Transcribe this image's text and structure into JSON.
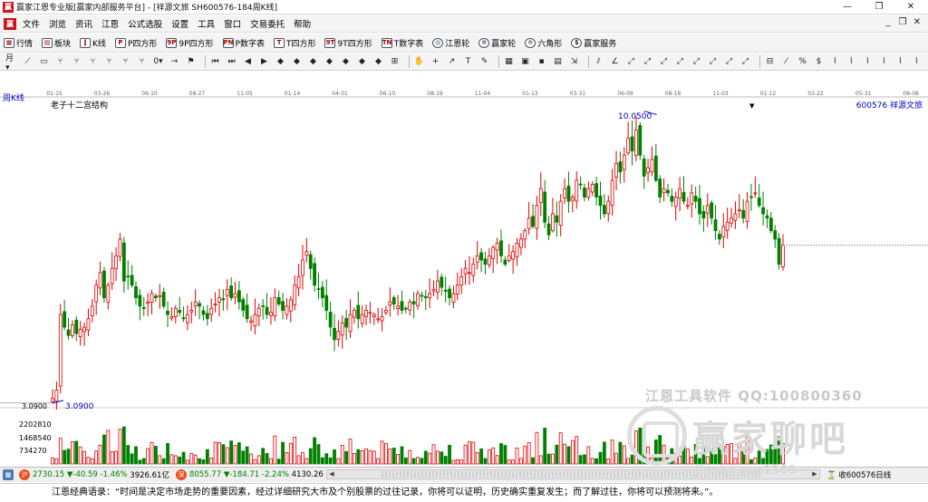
{
  "window": {
    "title": "赢家江恩专业版[赢家内部服务平台] - [祥源文旅  SH600576-184周K线]",
    "minimize": "—",
    "maximize": "❐",
    "close": "✕"
  },
  "menu": {
    "items": [
      "文件",
      "浏览",
      "资讯",
      "江恩",
      "公式选股",
      "设置",
      "工具",
      "窗口",
      "交易委托",
      "帮助"
    ]
  },
  "toolbar1": {
    "items": [
      {
        "label": "行情",
        "icon": "grid-icon"
      },
      {
        "label": "板块",
        "icon": "blocks-icon"
      },
      {
        "label": "K线",
        "icon": "candle-icon"
      },
      {
        "label": "P四方形",
        "icon": "p-square-icon"
      },
      {
        "label": "9P四方形",
        "icon": "9p-square-icon"
      },
      {
        "label": "P数字表",
        "icon": "p-table-icon"
      },
      {
        "label": "T四方形",
        "icon": "t-square-icon"
      },
      {
        "label": "9T四方形",
        "icon": "9t-square-icon"
      },
      {
        "label": "T数字表",
        "icon": "t-table-icon"
      },
      {
        "label": "江恩轮",
        "icon": "gann-wheel-icon"
      },
      {
        "label": "赢家轮",
        "icon": "winner-wheel-icon"
      },
      {
        "label": "六角形",
        "icon": "hexagon-icon"
      },
      {
        "label": "赢家服务",
        "icon": "dollar-icon"
      }
    ]
  },
  "chart": {
    "cycle": "周K线",
    "title": "老子十二宫结构",
    "code_name": "600576  祥源文旅",
    "high_label": "10.0500",
    "low_label": "3.0900",
    "low_axis": "3.0900",
    "vol_ticks": [
      "2202810",
      "1468540",
      "734270"
    ],
    "watermark_line1": "江恩工具软件   QQ:100800360",
    "watermark_line2": "赢家聊吧",
    "watermark_line3": "jiaoba.yuc1360",
    "date_ticks": [
      "01-15",
      "03-26",
      "06-10",
      "08-27",
      "11-05",
      "01-14",
      "04-01",
      "06-10",
      "08-19",
      "11-04",
      "01-13",
      "03-31",
      "06-09",
      "08-18",
      "11-03",
      "01-12",
      "03-22",
      "05-31",
      "08-08"
    ]
  },
  "chart_data": {
    "type": "candlestick",
    "title": "老子十二宫结构",
    "period": "周K线",
    "high": 10.05,
    "low": 3.09,
    "ylim": [
      3.0,
      10.3
    ],
    "close": [
      3.2,
      3.4,
      5.2,
      4.9,
      4.7,
      4.95,
      4.75,
      4.85,
      4.9,
      5.1,
      5.4,
      5.9,
      6.2,
      5.6,
      5.9,
      6.3,
      6.6,
      7.0,
      6.0,
      6.1,
      5.9,
      5.6,
      5.4,
      5.35,
      5.5,
      5.7,
      5.6,
      5.65,
      5.4,
      5.2,
      5.15,
      5.35,
      5.25,
      5.1,
      5.2,
      5.3,
      5.5,
      5.4,
      5.2,
      5.1,
      5.35,
      5.45,
      5.6,
      5.55,
      5.8,
      5.6,
      5.7,
      5.5,
      5.3,
      5.1,
      5.05,
      5.2,
      5.35,
      5.4,
      5.2,
      5.25,
      5.6,
      5.45,
      5.3,
      5.4,
      5.55,
      5.9,
      6.1,
      6.5,
      6.7,
      6.3,
      5.9,
      5.8,
      5.6,
      5.3,
      4.9,
      4.6,
      4.8,
      5.0,
      4.9,
      5.2,
      5.3,
      5.1,
      5.2,
      5.3,
      5.25,
      5.2,
      5.1,
      5.15,
      5.3,
      5.5,
      5.45,
      5.4,
      5.3,
      5.35,
      5.5,
      5.45,
      5.7,
      5.65,
      5.6,
      5.7,
      5.8,
      6.0,
      5.85,
      5.75,
      5.6,
      5.7,
      5.9,
      6.1,
      6.3,
      6.2,
      6.4,
      6.6,
      6.5,
      6.4,
      6.6,
      6.8,
      6.9,
      6.6,
      6.4,
      6.6,
      6.7,
      6.9,
      7.0,
      7.2,
      7.5,
      7.3,
      7.8,
      8.2,
      7.4,
      7.1,
      7.6,
      7.4,
      7.9,
      8.2,
      7.9,
      8.0,
      8.4,
      8.3,
      8.0,
      8.2,
      8.3,
      8.0,
      7.8,
      7.6,
      7.9,
      8.4,
      8.8,
      8.6,
      9.0,
      9.4,
      9.1,
      9.6,
      9.0,
      8.5,
      8.7,
      8.9,
      8.4,
      8.0,
      8.2,
      8.1,
      7.9,
      8.0,
      8.2,
      7.9,
      7.8,
      8.1,
      7.9,
      7.6,
      7.5,
      7.8,
      7.5,
      7.2,
      7.0,
      7.3,
      7.4,
      7.5,
      7.6,
      7.7,
      7.5,
      7.9,
      8.0,
      8.1,
      7.8,
      7.6,
      7.5,
      7.2,
      7.0,
      6.4,
      6.85
    ],
    "last_price_line": 6.85,
    "volume_ticks": [
      734270,
      1468540,
      2202810
    ]
  },
  "bottombar": {
    "sh_icon": "沪",
    "sh_value": "2730.15",
    "sh_change": "▼-40.59",
    "sh_pct": "-1.46%",
    "sh_amount": "3926.61亿",
    "sz_icon": "深",
    "sz_value": "8055.77",
    "sz_change": "▼-184.71",
    "sz_pct": "-2.24%",
    "sz_amount": "4130.26",
    "right_label": "收600576日线"
  },
  "quote": {
    "text": "江恩经典语录：“时间是决定市场走势的重要因素，经过详细研究大市及个别股票的过往记录，你将可以证明，历史确实重复发生；而了解过往，你将可以预测将来。”。"
  },
  "colors": {
    "up": "#e00000",
    "down": "#008000",
    "price_line": "#0000c8"
  }
}
